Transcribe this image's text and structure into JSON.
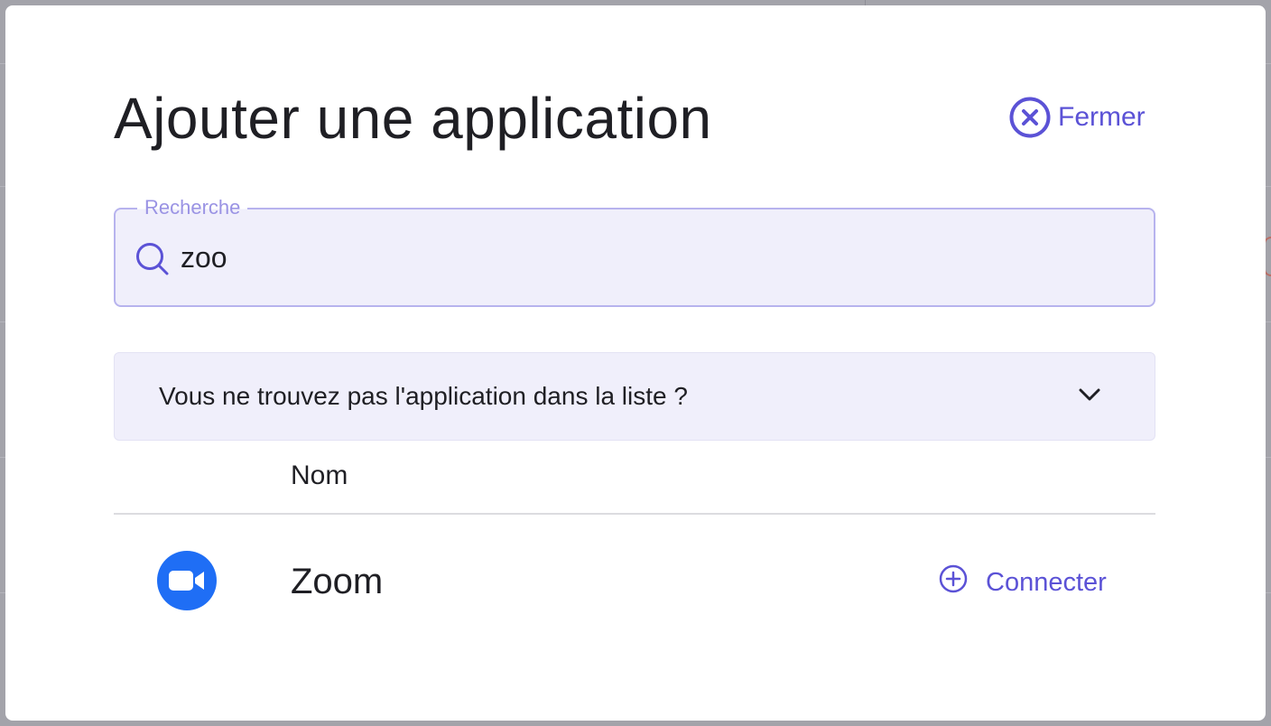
{
  "dialog": {
    "title": "Ajouter une application",
    "close_label": "Fermer"
  },
  "search": {
    "legend": "Recherche",
    "value": "zoo"
  },
  "help": {
    "label": "Vous ne trouvez pas l'application dans la liste ?"
  },
  "table": {
    "columns": [
      "Nom"
    ],
    "rows": [
      {
        "name": "Zoom",
        "action_label": "Connecter",
        "icon": "zoom-video-icon"
      }
    ]
  },
  "colors": {
    "accent": "#5b52d6",
    "search_bg": "#f0effb",
    "zoom_brand": "#1f6ef5",
    "text": "#1f1f24"
  }
}
